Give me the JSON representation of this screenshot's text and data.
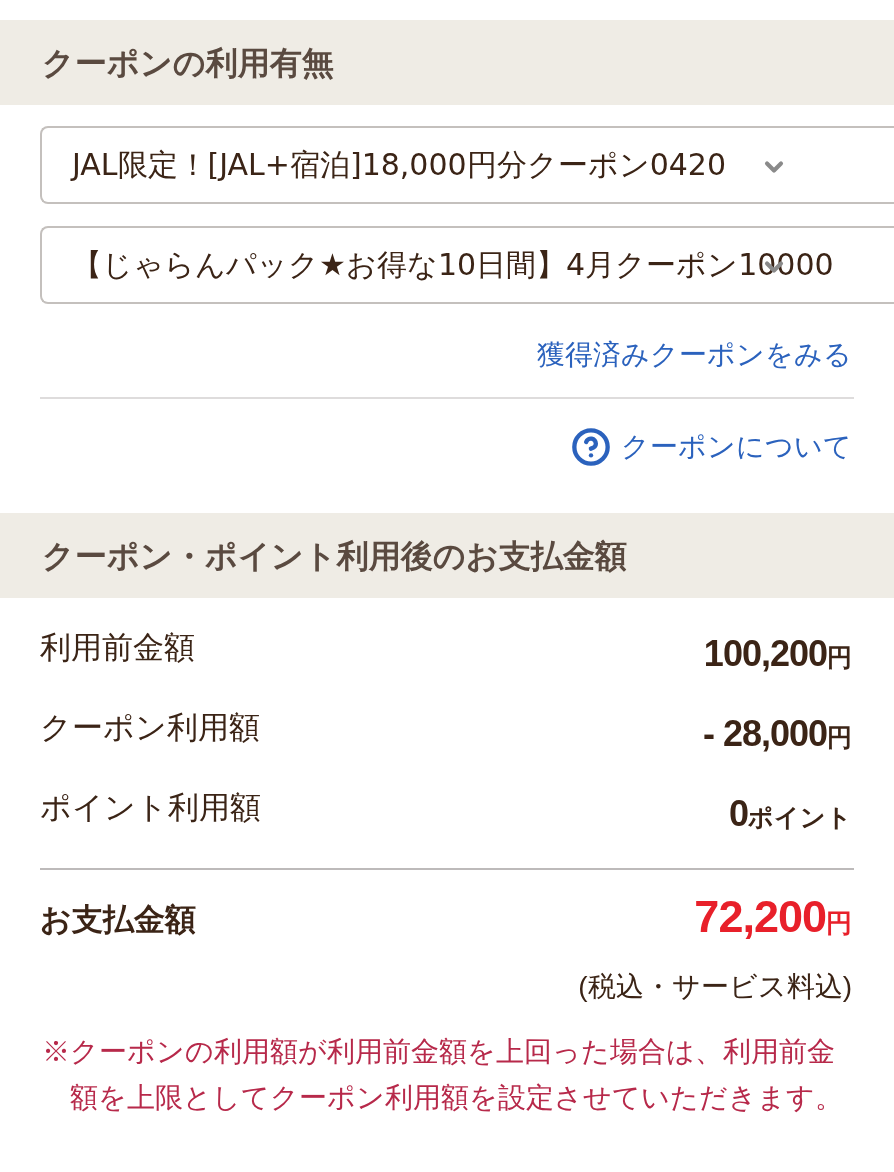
{
  "coupon_section": {
    "title": "クーポンの利用有無",
    "selects": [
      {
        "value": "JAL限定！[JAL+宿泊]18,000円分クーポン0420"
      },
      {
        "value": "【じゃらんパック★お得な10日間】4月クーポン10000"
      }
    ],
    "acquired_coupons_link": "獲得済みクーポンをみる",
    "about_coupons_link": "クーポンについて"
  },
  "payment_section": {
    "title": "クーポン・ポイント利用後のお支払金額",
    "rows": [
      {
        "label": "利用前金額",
        "amount": "100,200",
        "unit": "円"
      },
      {
        "label": "クーポン利用額",
        "amount": "- 28,000",
        "unit": "円"
      },
      {
        "label": "ポイント利用額",
        "amount": "0",
        "unit": "ポイント"
      }
    ],
    "total": {
      "label": "お支払金額",
      "amount": "72,200",
      "unit": "円"
    },
    "tax_note": "(税込・サービス料込)",
    "notice": "※クーポンの利用額が利用前金額を上回った場合は、利用前金額を上限としてクーポン利用額を設定させていただきます。"
  }
}
